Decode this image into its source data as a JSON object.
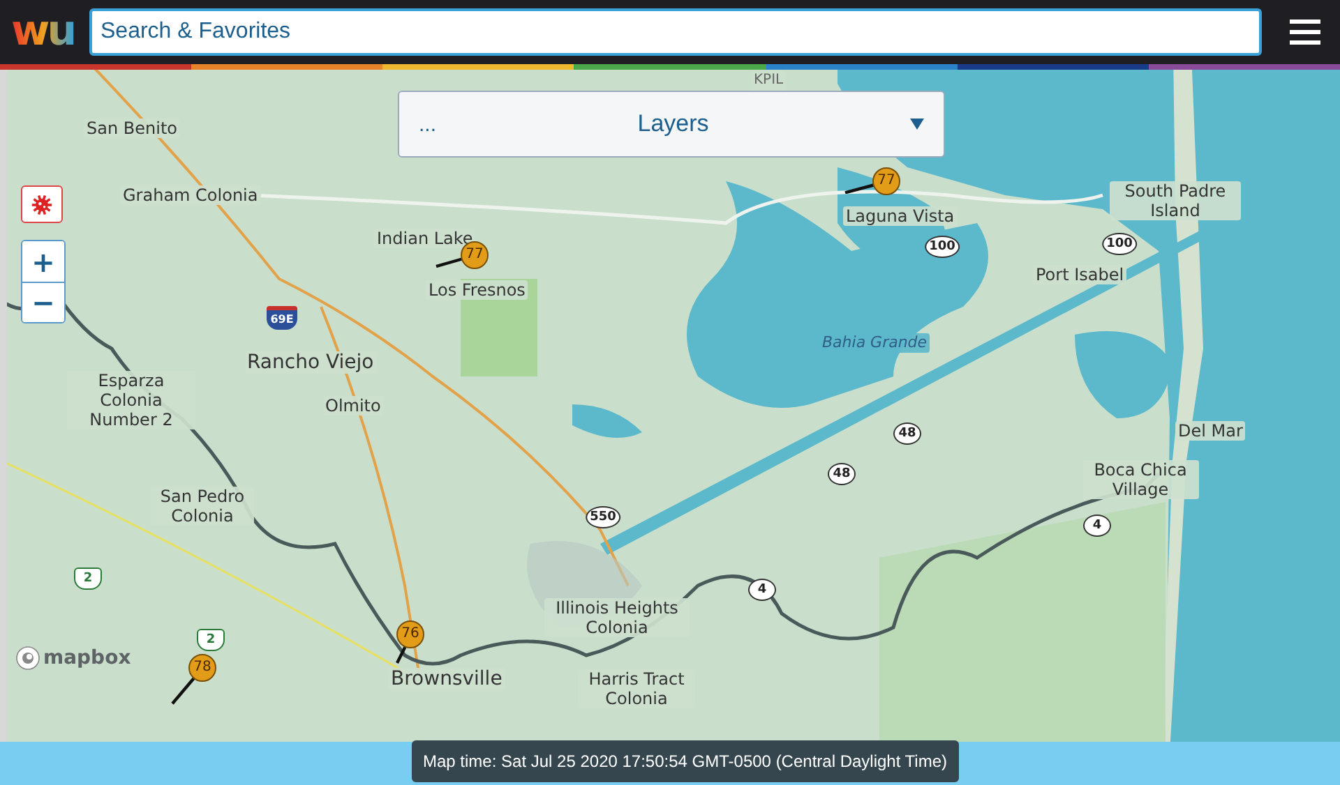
{
  "header": {
    "logo": "wu",
    "search": {
      "placeholder": "Search & Favorites"
    }
  },
  "layers": {
    "prefix": "...",
    "label": "Layers"
  },
  "map": {
    "places": [
      {
        "name": "KPIL",
        "kind": "airport"
      },
      {
        "name": "San Benito",
        "kind": "town"
      },
      {
        "name": "Graham Colonia",
        "kind": "town"
      },
      {
        "name": "Indian Lake",
        "kind": "town"
      },
      {
        "name": "Los Fresnos",
        "kind": "town"
      },
      {
        "name": "Laguna Vista",
        "kind": "town"
      },
      {
        "name": "South Padre Island",
        "kind": "town"
      },
      {
        "name": "Port Isabel",
        "kind": "town"
      },
      {
        "name": "Bahia Grande",
        "kind": "water"
      },
      {
        "name": "Rancho Viejo",
        "kind": "city"
      },
      {
        "name": "Esparza Colonia Number 2",
        "kind": "town"
      },
      {
        "name": "Olmito",
        "kind": "town"
      },
      {
        "name": "Del Mar",
        "kind": "town"
      },
      {
        "name": "Boca Chica Village",
        "kind": "town"
      },
      {
        "name": "San Pedro Colonia",
        "kind": "town"
      },
      {
        "name": "Illinois Heights Colonia",
        "kind": "town"
      },
      {
        "name": "Brownsville",
        "kind": "city"
      },
      {
        "name": "Harris Tract Colonia",
        "kind": "town"
      }
    ],
    "shields": [
      {
        "number": "100",
        "kind": "state"
      },
      {
        "number": "100",
        "kind": "state"
      },
      {
        "number": "69E",
        "kind": "interstate"
      },
      {
        "number": "48",
        "kind": "state"
      },
      {
        "number": "48",
        "kind": "state"
      },
      {
        "number": "550",
        "kind": "state"
      },
      {
        "number": "4",
        "kind": "state"
      },
      {
        "number": "4",
        "kind": "state"
      },
      {
        "number": "2",
        "kind": "us"
      },
      {
        "number": "2",
        "kind": "us"
      }
    ],
    "stations": [
      {
        "temp": "77"
      },
      {
        "temp": "77"
      },
      {
        "temp": "76"
      },
      {
        "temp": "78"
      }
    ],
    "zoom_in": "+",
    "zoom_out": "−",
    "attribution": "mapbox"
  },
  "map_time": "Map time: Sat Jul 25 2020 17:50:54 GMT-0500 (Central Daylight Time)"
}
